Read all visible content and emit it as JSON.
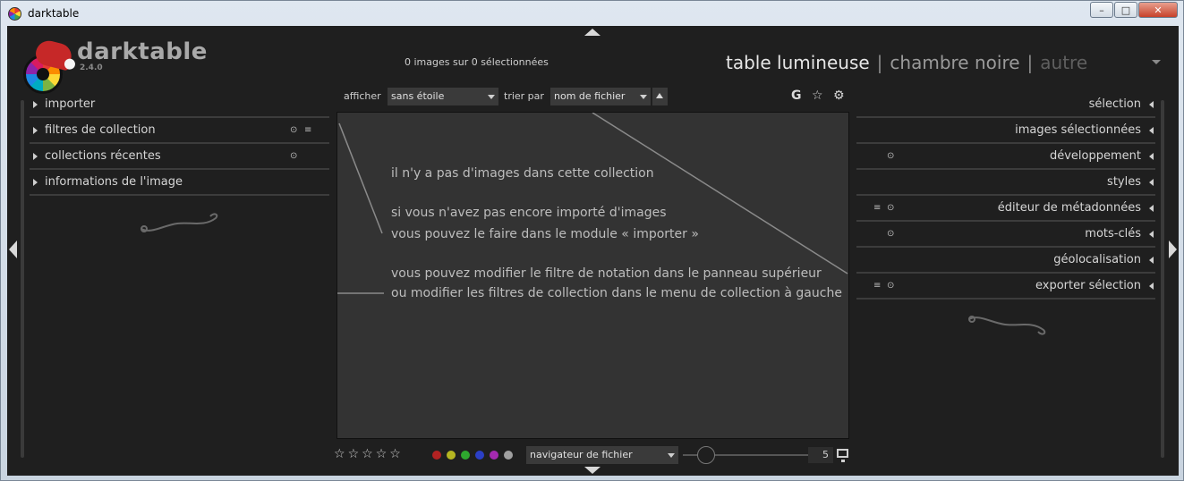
{
  "window": {
    "title": "darktable",
    "minimize": "–",
    "maximize": "□",
    "close": "✕"
  },
  "header": {
    "brand": "darktable",
    "version": "2.4.0",
    "image_count": "0 images sur 0 sélectionnées",
    "views": {
      "lighttable": "table lumineuse",
      "separator": "|",
      "darkroom": "chambre noire",
      "other": "autre"
    }
  },
  "left_panel": {
    "modules": [
      {
        "label": "importer"
      },
      {
        "label": "filtres de collection",
        "icon_a": "⊙",
        "icon_b": "≡"
      },
      {
        "label": "collections récentes",
        "icon_a": "⊙"
      },
      {
        "label": "informations de l'image"
      }
    ]
  },
  "right_panel": {
    "modules": [
      {
        "label": "sélection"
      },
      {
        "label": "images sélectionnées"
      },
      {
        "label": "développement",
        "icon_a": "⊙"
      },
      {
        "label": "styles"
      },
      {
        "label": "éditeur de métadonnées",
        "icon_a": "⊙",
        "icon_b": "≡"
      },
      {
        "label": "mots-clés",
        "icon_a": "⊙"
      },
      {
        "label": "géolocalisation"
      },
      {
        "label": "exporter sélection",
        "icon_a": "⊙",
        "icon_b": "≡"
      }
    ]
  },
  "toolbar": {
    "show_label": "afficher",
    "show_value": "sans étoile",
    "sort_label": "trier par",
    "sort_value": "nom de fichier",
    "grouping_icon": "G",
    "star_icon": "☆",
    "gear_icon": "⚙"
  },
  "center": {
    "line1": "il n'y a pas d'images dans cette collection",
    "line2": "si vous n'avez pas encore importé d'images",
    "line3": "vous pouvez le faire dans le module « importer »",
    "line4": "vous pouvez modifier le filtre de notation dans le panneau supérieur",
    "line5": "ou modifier les filtres de collection dans le menu de collection à gauche"
  },
  "bottom": {
    "stars": [
      "☆",
      "☆",
      "☆",
      "☆",
      "☆"
    ],
    "color_labels": [
      "#b22222",
      "#b5b521",
      "#2ea82e",
      "#2b3fc6",
      "#a52ab0",
      "#a0a0a0"
    ],
    "navigator_value": "navigateur de fichier",
    "zoom_value": "5"
  }
}
